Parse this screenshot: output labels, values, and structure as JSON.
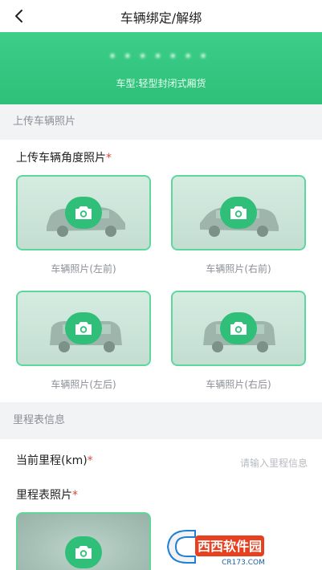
{
  "nav": {
    "title": "车辆绑定/解绑",
    "back_icon": "back-chevron-icon"
  },
  "vehicle": {
    "plate_blurred": "•••••••",
    "type": "车型:轻型封闭式厢货"
  },
  "sections": {
    "photo_upload": "上传车辆照片",
    "odometer": "里程表信息"
  },
  "angle_photos": {
    "label": "上传车辆角度照片",
    "required_mark": "*",
    "items": [
      {
        "caption": "车辆照片(左前)"
      },
      {
        "caption": "车辆照片(右前)"
      },
      {
        "caption": "车辆照片(左后)"
      },
      {
        "caption": "车辆照片(右后)"
      }
    ]
  },
  "mileage": {
    "label": "当前里程(km)",
    "required_mark": "*",
    "placeholder": "请输入里程信息"
  },
  "odometer_photo": {
    "label": "里程表照片",
    "required_mark": "*"
  },
  "watermark": {
    "brand": "西西软件园",
    "domain": "CR173.COM"
  },
  "colors": {
    "brand_green": "#2fbf78",
    "border_green": "#5fd69c",
    "required_red": "#e0463c"
  }
}
